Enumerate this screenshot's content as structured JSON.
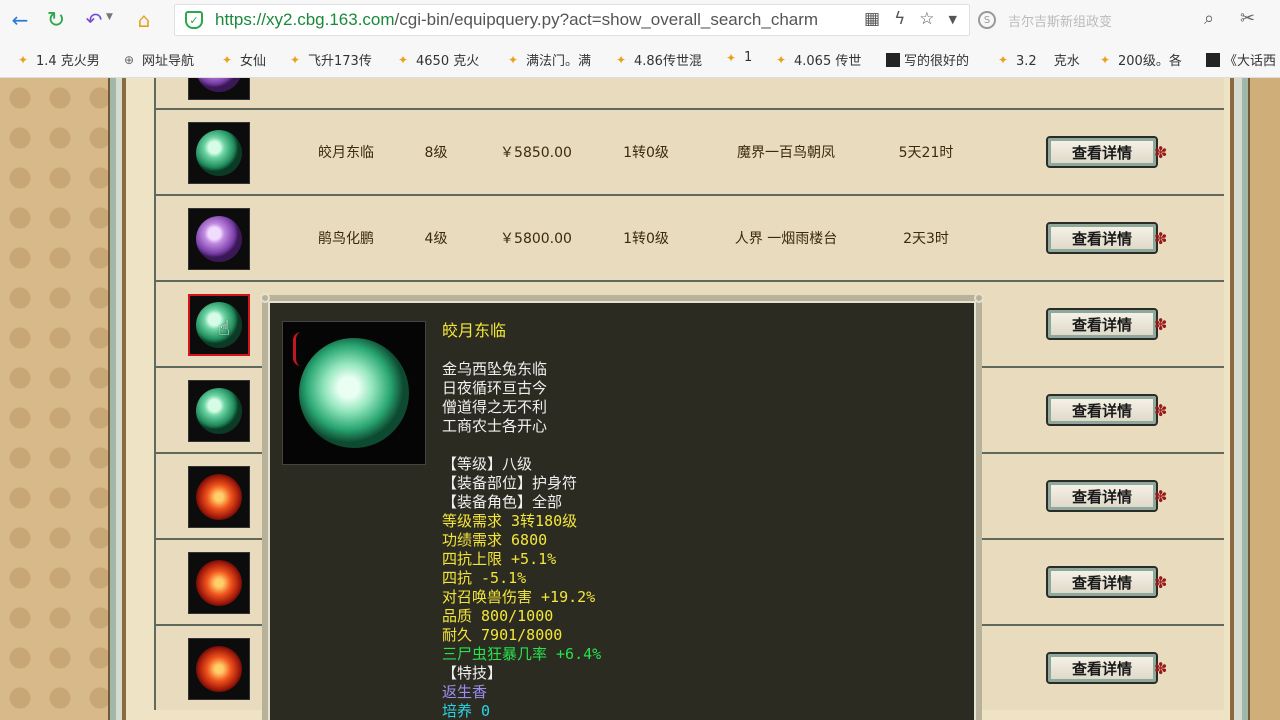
{
  "browser": {
    "url_prefix": "https://",
    "url_host": "xy2.cbg.163.com",
    "url_path": "/cgi-bin/equipquery.py?act=show_overall_search_charm",
    "search_placeholder": "吉尔吉斯新组政变"
  },
  "bookmarks": [
    {
      "label": "1.4 克火男",
      "icon": "star-coin-icon"
    },
    {
      "label": "网址导航",
      "icon": "globe-icon"
    },
    {
      "label": "女仙",
      "icon": "star-coin-icon"
    },
    {
      "label": "飞升173传",
      "icon": "star-coin-icon"
    },
    {
      "label": "4650 克火",
      "icon": "star-coin-icon"
    },
    {
      "label": "满法门。满",
      "icon": "star-coin-icon"
    },
    {
      "label": "4.86传世混",
      "icon": "star-coin-icon"
    },
    {
      "label": "1",
      "icon": "star-coin-icon"
    },
    {
      "label": "4.065 传世",
      "icon": "star-coin-icon"
    },
    {
      "label": "写的很好的",
      "icon": "thumbnail-icon"
    },
    {
      "label": "3.2 　克水",
      "icon": "star-coin-icon"
    },
    {
      "label": "200级。各",
      "icon": "star-coin-icon"
    },
    {
      "label": "《大话西",
      "icon": "thumbnail-icon"
    }
  ],
  "table": {
    "detail_label": "查看详情",
    "rows": [
      {
        "orb": "purple",
        "name": "",
        "level": "",
        "price": "",
        "rebirth": "",
        "server": "",
        "time": ""
      },
      {
        "orb": "jade",
        "name": "皎月东临",
        "level": "8级",
        "price": "￥5850.00",
        "rebirth": "1转0级",
        "server": "魔界一百鸟朝凤",
        "time": "5天21时"
      },
      {
        "orb": "purple",
        "name": "鹃鸟化鹏",
        "level": "4级",
        "price": "￥5800.00",
        "rebirth": "1转0级",
        "server": "人界 一烟雨楼台",
        "time": "2天3时"
      },
      {
        "orb": "jade",
        "name": "",
        "level": "",
        "price": "",
        "rebirth": "",
        "server": "",
        "time": ""
      },
      {
        "orb": "jade",
        "name": "",
        "level": "",
        "price": "",
        "rebirth": "",
        "server": "",
        "time": ""
      },
      {
        "orb": "red",
        "name": "",
        "level": "",
        "price": "",
        "rebirth": "",
        "server": "",
        "time": ""
      },
      {
        "orb": "red",
        "name": "",
        "level": "",
        "price": "",
        "rebirth": "",
        "server": "",
        "time": ""
      },
      {
        "orb": "red",
        "name": "",
        "level": "",
        "price": "",
        "rebirth": "",
        "server": "",
        "time": ""
      }
    ]
  },
  "popup": {
    "name": "皎月东临",
    "poem": [
      "金乌西坠兔东临",
      "日夜循环亘古今",
      "僧道得之无不利",
      "工商农士各开心"
    ],
    "level": "【等级】八级",
    "slot": "【装备部位】护身符",
    "role": "【装备角色】全部",
    "req_level": "等级需求 3转180级",
    "req_merit": "功绩需求 6800",
    "stat1": "四抗上限 +5.1%",
    "stat2": "四抗 -5.1%",
    "stat3": "对召唤兽伤害 +19.2%",
    "quality": "品质 800/1000",
    "durability": "耐久 7901/8000",
    "special_stat": "三尸虫狂暴几率 +6.4%",
    "skill_header": "【特技】",
    "skill": "返生香",
    "cultivate": "培养 0"
  }
}
